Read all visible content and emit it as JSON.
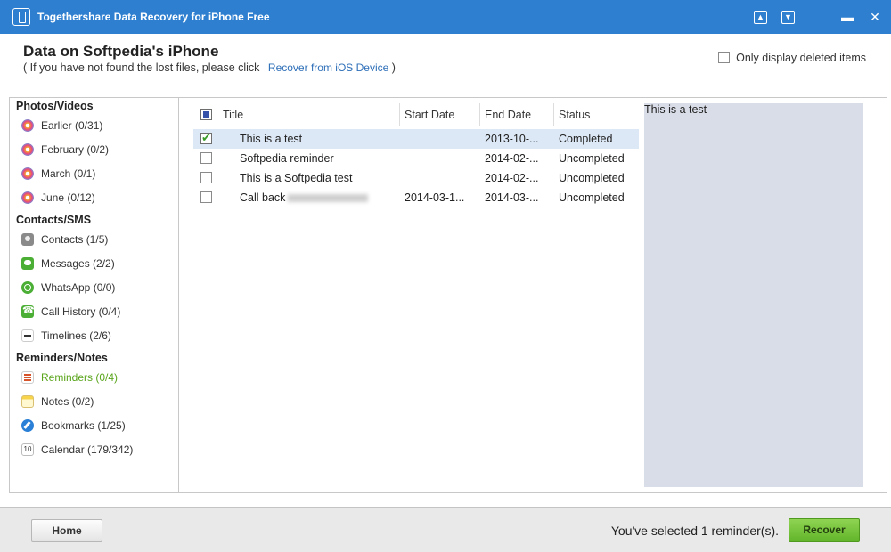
{
  "window": {
    "title": "Togethershare Data Recovery for iPhone Free"
  },
  "header": {
    "title": "Data on Softpedia's iPhone",
    "subtitle_prefix": "( If you have not found the lost files, please click",
    "subtitle_link": "Recover from iOS Device",
    "subtitle_suffix": ")",
    "deleted_only_label": "Only display deleted items"
  },
  "sidebar": {
    "groups": [
      {
        "title": "Photos/Videos",
        "items": [
          {
            "label": "Earlier (0/31)",
            "icon": "photos-icon"
          },
          {
            "label": "February (0/2)",
            "icon": "photos-icon"
          },
          {
            "label": "March (0/1)",
            "icon": "photos-icon"
          },
          {
            "label": "June (0/12)",
            "icon": "photos-icon"
          }
        ]
      },
      {
        "title": "Contacts/SMS",
        "items": [
          {
            "label": "Contacts (1/5)",
            "icon": "contacts-icon"
          },
          {
            "label": "Messages (2/2)",
            "icon": "messages-icon"
          },
          {
            "label": "WhatsApp (0/0)",
            "icon": "whatsapp-icon"
          },
          {
            "label": "Call History (0/4)",
            "icon": "phone-icon"
          },
          {
            "label": "Timelines (2/6)",
            "icon": "timeline-icon"
          }
        ]
      },
      {
        "title": "Reminders/Notes",
        "items": [
          {
            "label": "Reminders (0/4)",
            "icon": "reminders-icon",
            "active": true
          },
          {
            "label": "Notes (0/2)",
            "icon": "notes-icon"
          },
          {
            "label": "Bookmarks (1/25)",
            "icon": "bookmarks-icon"
          },
          {
            "label": "Calendar (179/342)",
            "icon": "calendar-icon"
          }
        ]
      }
    ],
    "calendar_icon_day": "10"
  },
  "table": {
    "columns": [
      "Title",
      "Start Date",
      "End Date",
      "Status"
    ],
    "rows": [
      {
        "title": "This is a test",
        "start": "",
        "end": "2013-10-...",
        "status": "Completed",
        "checked": true
      },
      {
        "title": "Softpedia reminder",
        "start": "",
        "end": "2014-02-...",
        "status": "Uncompleted",
        "checked": false
      },
      {
        "title": "This is a Softpedia test",
        "start": "",
        "end": "2014-02-...",
        "status": "Uncompleted",
        "checked": false
      },
      {
        "title": "Call back",
        "start": "2014-03-1...",
        "end": "2014-03-...",
        "status": "Uncompleted",
        "checked": false
      }
    ]
  },
  "preview": {
    "text": "This is a test"
  },
  "footer": {
    "home_label": "Home",
    "status_message": "You've selected 1 reminder(s).",
    "recover_label": "Recover"
  },
  "colors": {
    "titlebar": "#2e7fd0",
    "accent_green": "#6ab82f",
    "selected_row": "#dde8f6",
    "preview_bg": "#d9dde7"
  }
}
